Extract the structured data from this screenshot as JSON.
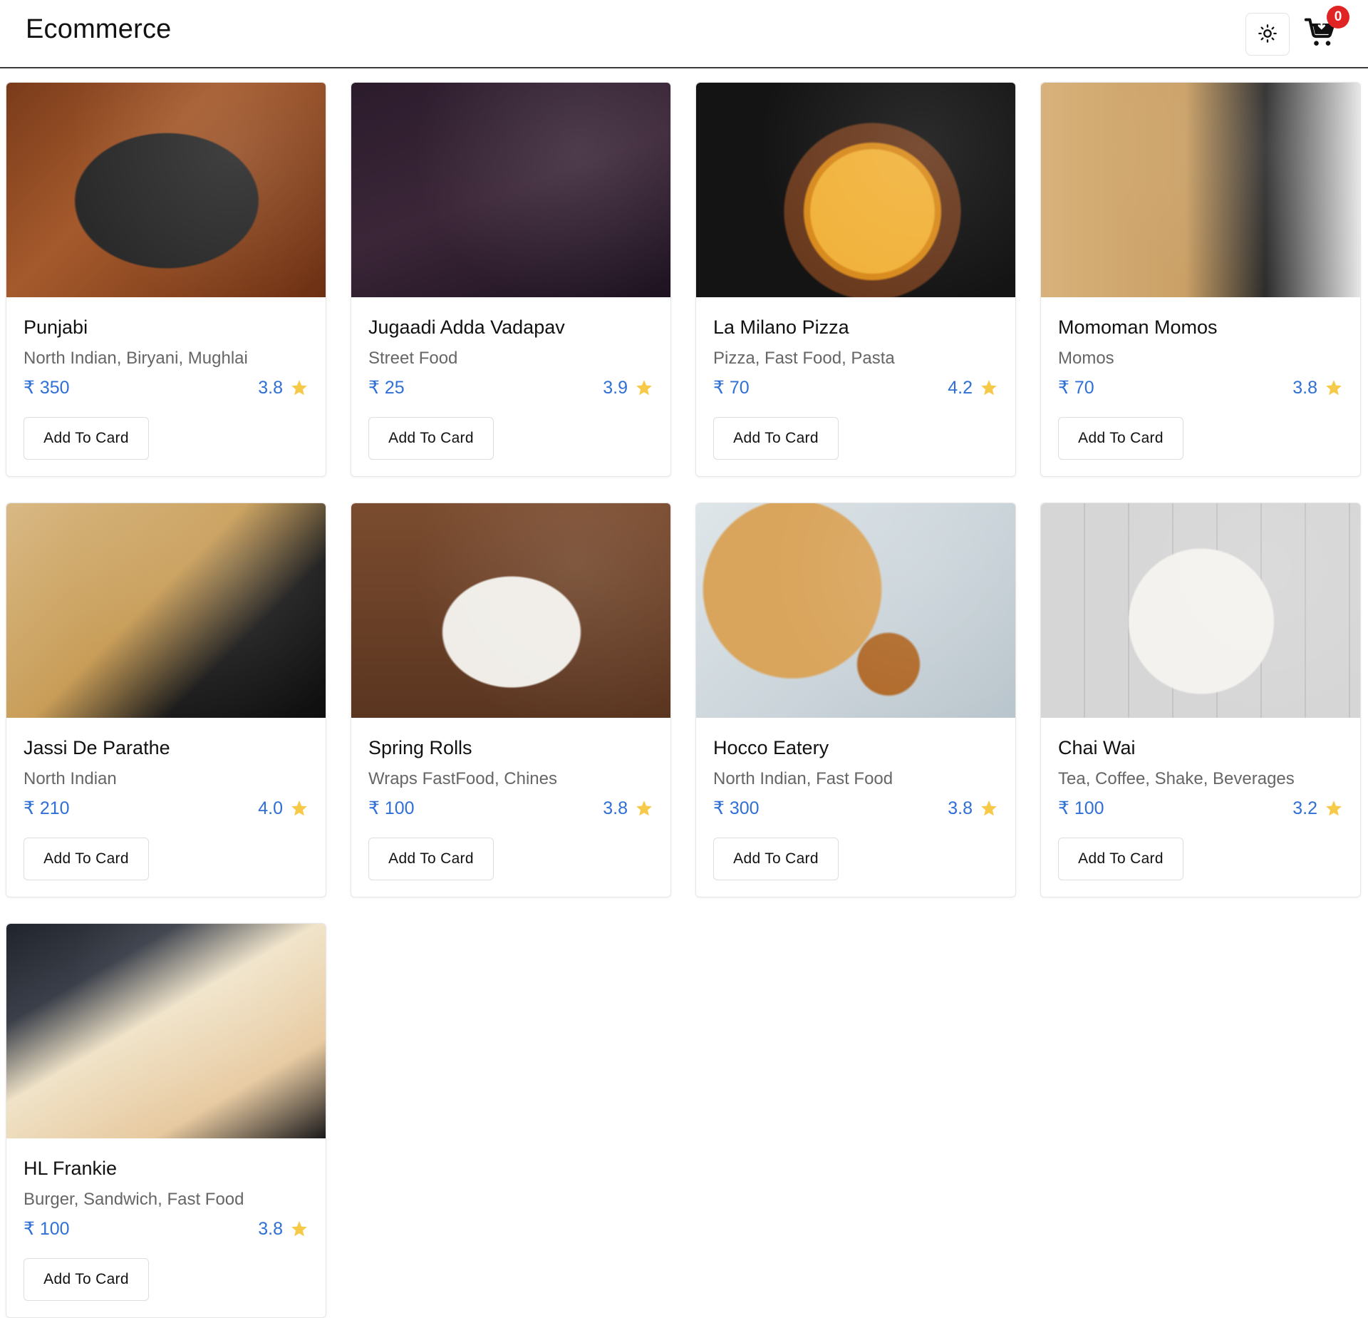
{
  "header": {
    "brand": "Ecommerce",
    "theme_toggle_icon": "sun-icon",
    "cart_icon": "cart-icon",
    "cart_count": "0"
  },
  "colors": {
    "accent": "#2f6fd6",
    "badge": "#e02424",
    "star": "#f7c948",
    "divider": "#3a3a3a"
  },
  "products": [
    {
      "name": "Punjabi",
      "cuisine": "North Indian, Biryani, Mughlai",
      "price": "₹ 350",
      "rating": "3.8",
      "button": "Add To Card"
    },
    {
      "name": "Jugaadi Adda Vadapav",
      "cuisine": "Street Food",
      "price": "₹ 25",
      "rating": "3.9",
      "button": "Add To Card"
    },
    {
      "name": "La Milano Pizza",
      "cuisine": "Pizza, Fast Food, Pasta",
      "price": "₹ 70",
      "rating": "4.2",
      "button": "Add To Card"
    },
    {
      "name": "Momoman Momos",
      "cuisine": "Momos",
      "price": "₹ 70",
      "rating": "3.8",
      "button": "Add To Card"
    },
    {
      "name": "Jassi De Parathe",
      "cuisine": "North Indian",
      "price": "₹ 210",
      "rating": "4.0",
      "button": "Add To Card"
    },
    {
      "name": "Spring Rolls",
      "cuisine": "Wraps FastFood, Chines",
      "price": "₹ 100",
      "rating": "3.8",
      "button": "Add To Card"
    },
    {
      "name": "Hocco Eatery",
      "cuisine": "North Indian, Fast Food",
      "price": "₹ 300",
      "rating": "3.8",
      "button": "Add To Card"
    },
    {
      "name": "Chai Wai",
      "cuisine": "Tea, Coffee, Shake, Beverages",
      "price": "₹ 100",
      "rating": "3.2",
      "button": "Add To Card"
    },
    {
      "name": "HL Frankie",
      "cuisine": "Burger, Sandwich, Fast Food",
      "price": "₹ 100",
      "rating": "3.8",
      "button": "Add To Card"
    }
  ]
}
